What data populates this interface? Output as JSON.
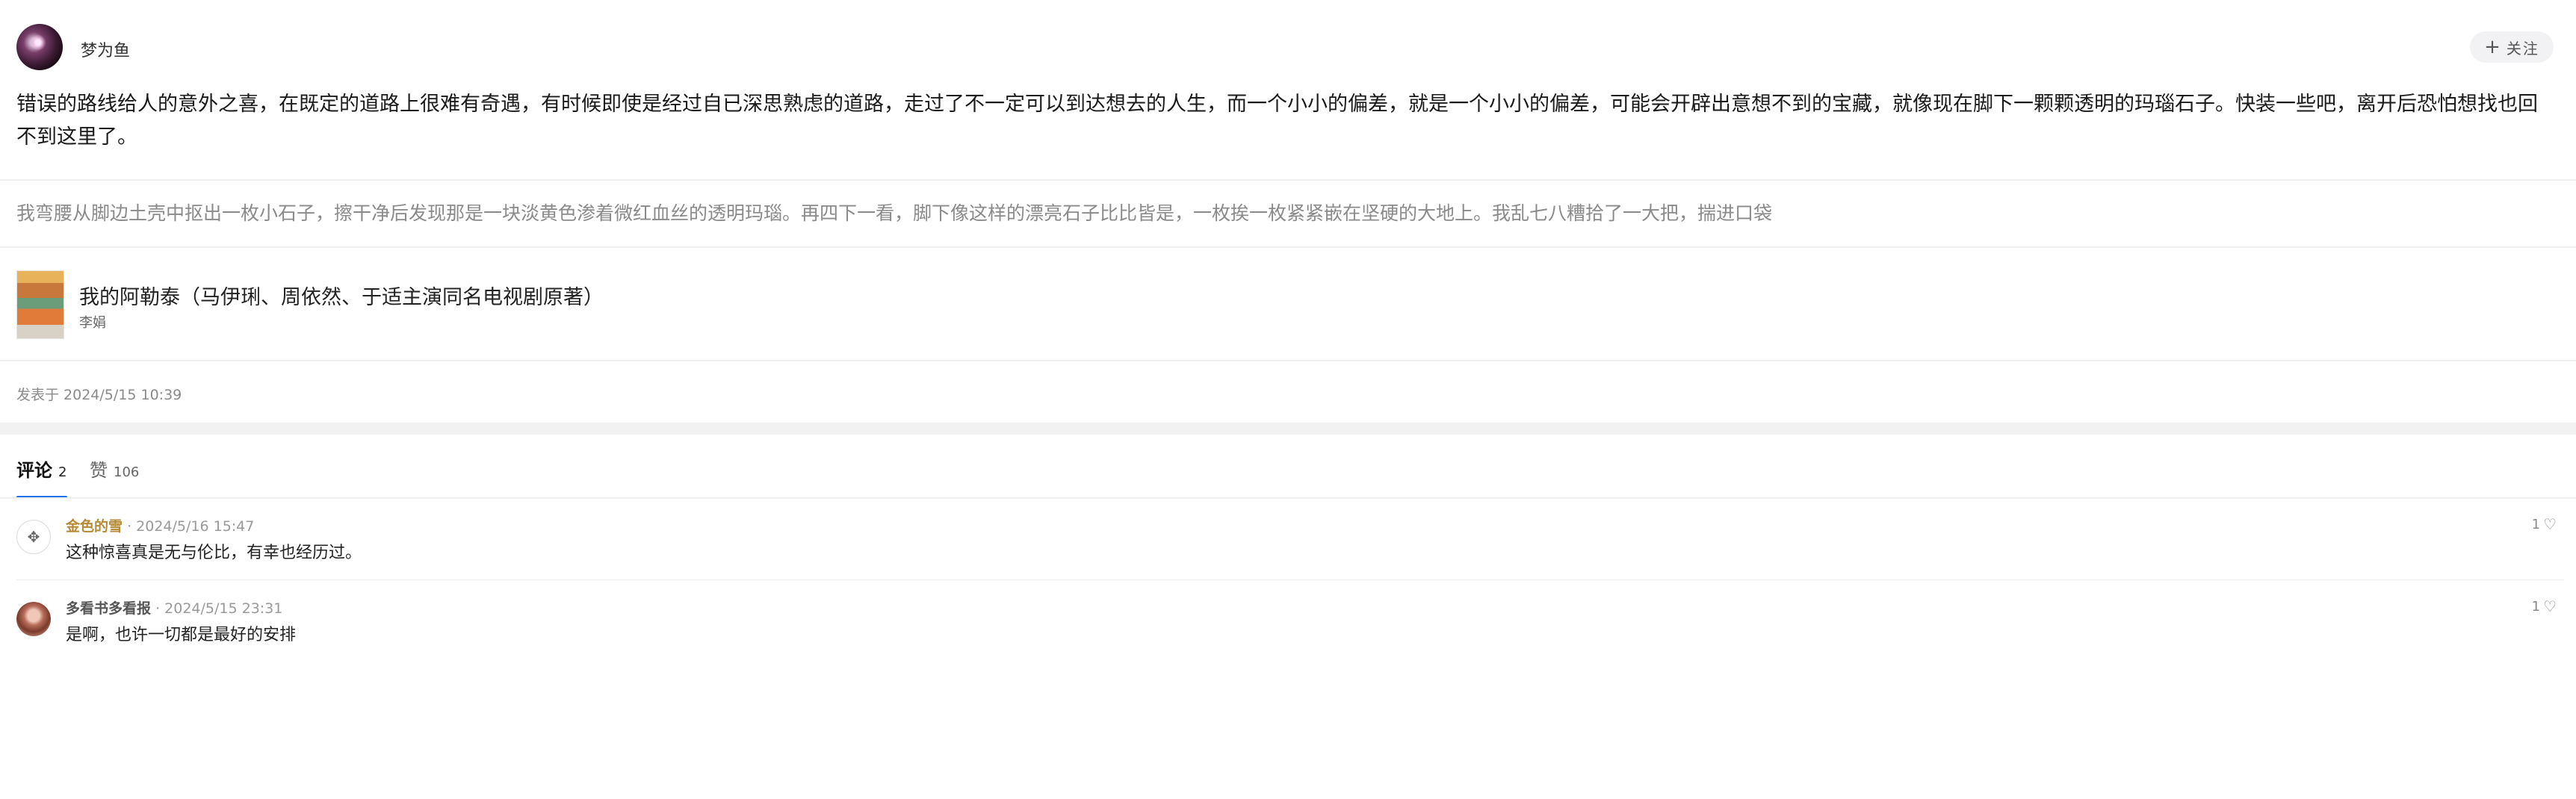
{
  "header": {
    "author_name": "梦为鱼",
    "follow_label": "关注"
  },
  "post": {
    "text": "错误的路线给人的意外之喜，在既定的道路上很难有奇遇，有时候即使是经过自已深思熟虑的道路，走过了不一定可以到达想去的人生，而一个小小的偏差，就是一个小小的偏差，可能会开辟出意想不到的宝藏，就像现在脚下一颗颗透明的玛瑙石子。快装一些吧，离开后恐怕想找也回不到这里了。",
    "quote": "我弯腰从脚边土壳中抠出一枚小石子，擦干净后发现那是一块淡黄色渗着微红血丝的透明玛瑙。再四下一看，脚下像这样的漂亮石子比比皆是，一枚挨一枚紧紧嵌在坚硬的大地上。我乱七八糟拾了一大把，揣进口袋",
    "book": {
      "title": "我的阿勒泰（马伊琍、周依然、于适主演同名电视剧原著）",
      "author": "李娟"
    },
    "posted_at": "发表于 2024/5/15 10:39"
  },
  "tabs": [
    {
      "label": "评论",
      "count": "2"
    },
    {
      "label": "赞",
      "count": "106"
    }
  ],
  "comments": [
    {
      "name": "金色的雪",
      "time": "· 2024/5/16 15:47",
      "text": "这种惊喜真是无与伦比，有幸也经历过。",
      "likes": "1"
    },
    {
      "name": "多看书多看报",
      "time": "· 2024/5/15 23:31",
      "text": "是啊，也许一切都是最好的安排",
      "likes": "1"
    }
  ],
  "colors": {
    "accent": "#1a73e8",
    "gold_name": "#b58a36"
  }
}
